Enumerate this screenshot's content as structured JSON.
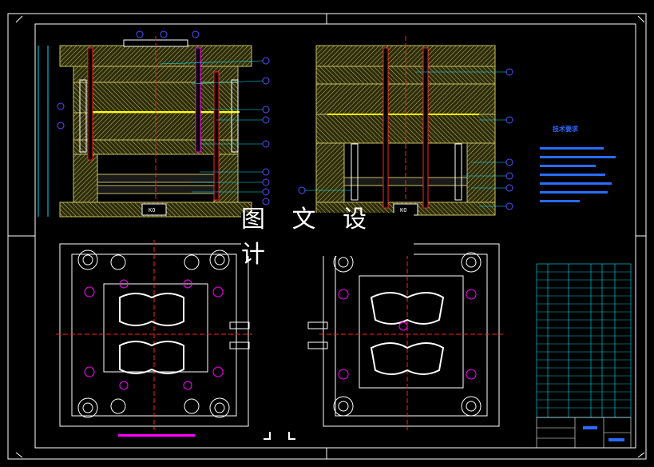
{
  "watermark": "图 文 设 计",
  "side_view_left": {
    "label": "KO"
  },
  "side_view_right": {
    "label": "KO"
  },
  "notes_title": "技术要求",
  "colors": {
    "frame": "#ffffff",
    "plate_fill": "#3a3a10",
    "hatch": "#c8c060",
    "cyan": "#00e5ff",
    "magenta": "#ff00ff",
    "red": "#ff2020",
    "blue": "#2a6bff",
    "green": "#00c000"
  },
  "icons": [
    "balloon-callout-icon",
    "ejector-pin-icon",
    "guide-pillar-icon"
  ]
}
